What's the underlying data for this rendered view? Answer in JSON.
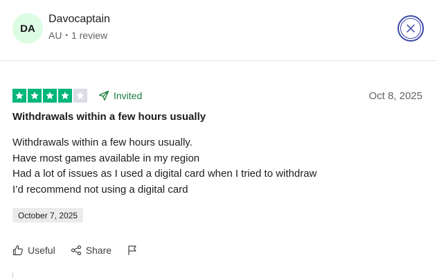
{
  "reviewer": {
    "initials": "DA",
    "name": "Davocaptain",
    "country": "AU",
    "separator": "•",
    "review_count": "1 review"
  },
  "rating": {
    "stars": 4,
    "max_stars": 5,
    "filled_color": "#00b67a",
    "empty_color": "#dcdce6"
  },
  "invited_label": "Invited",
  "review_date": "Oct 8, 2025",
  "title": "Withdrawals within a few hours usually",
  "body_lines": [
    "Withdrawals within a few hours usually.",
    "Have most games available in my region",
    "Had a lot of issues as I used a digital card when I tried to withdraw",
    "I’d recommend not using a digital card"
  ],
  "experience_date": "October 7, 2025",
  "actions": {
    "useful": "Useful",
    "share": "Share"
  },
  "icons": {
    "close": "close-icon",
    "invited": "send-icon",
    "useful": "thumbs-up-icon",
    "share": "share-icon",
    "report": "flag-icon"
  }
}
